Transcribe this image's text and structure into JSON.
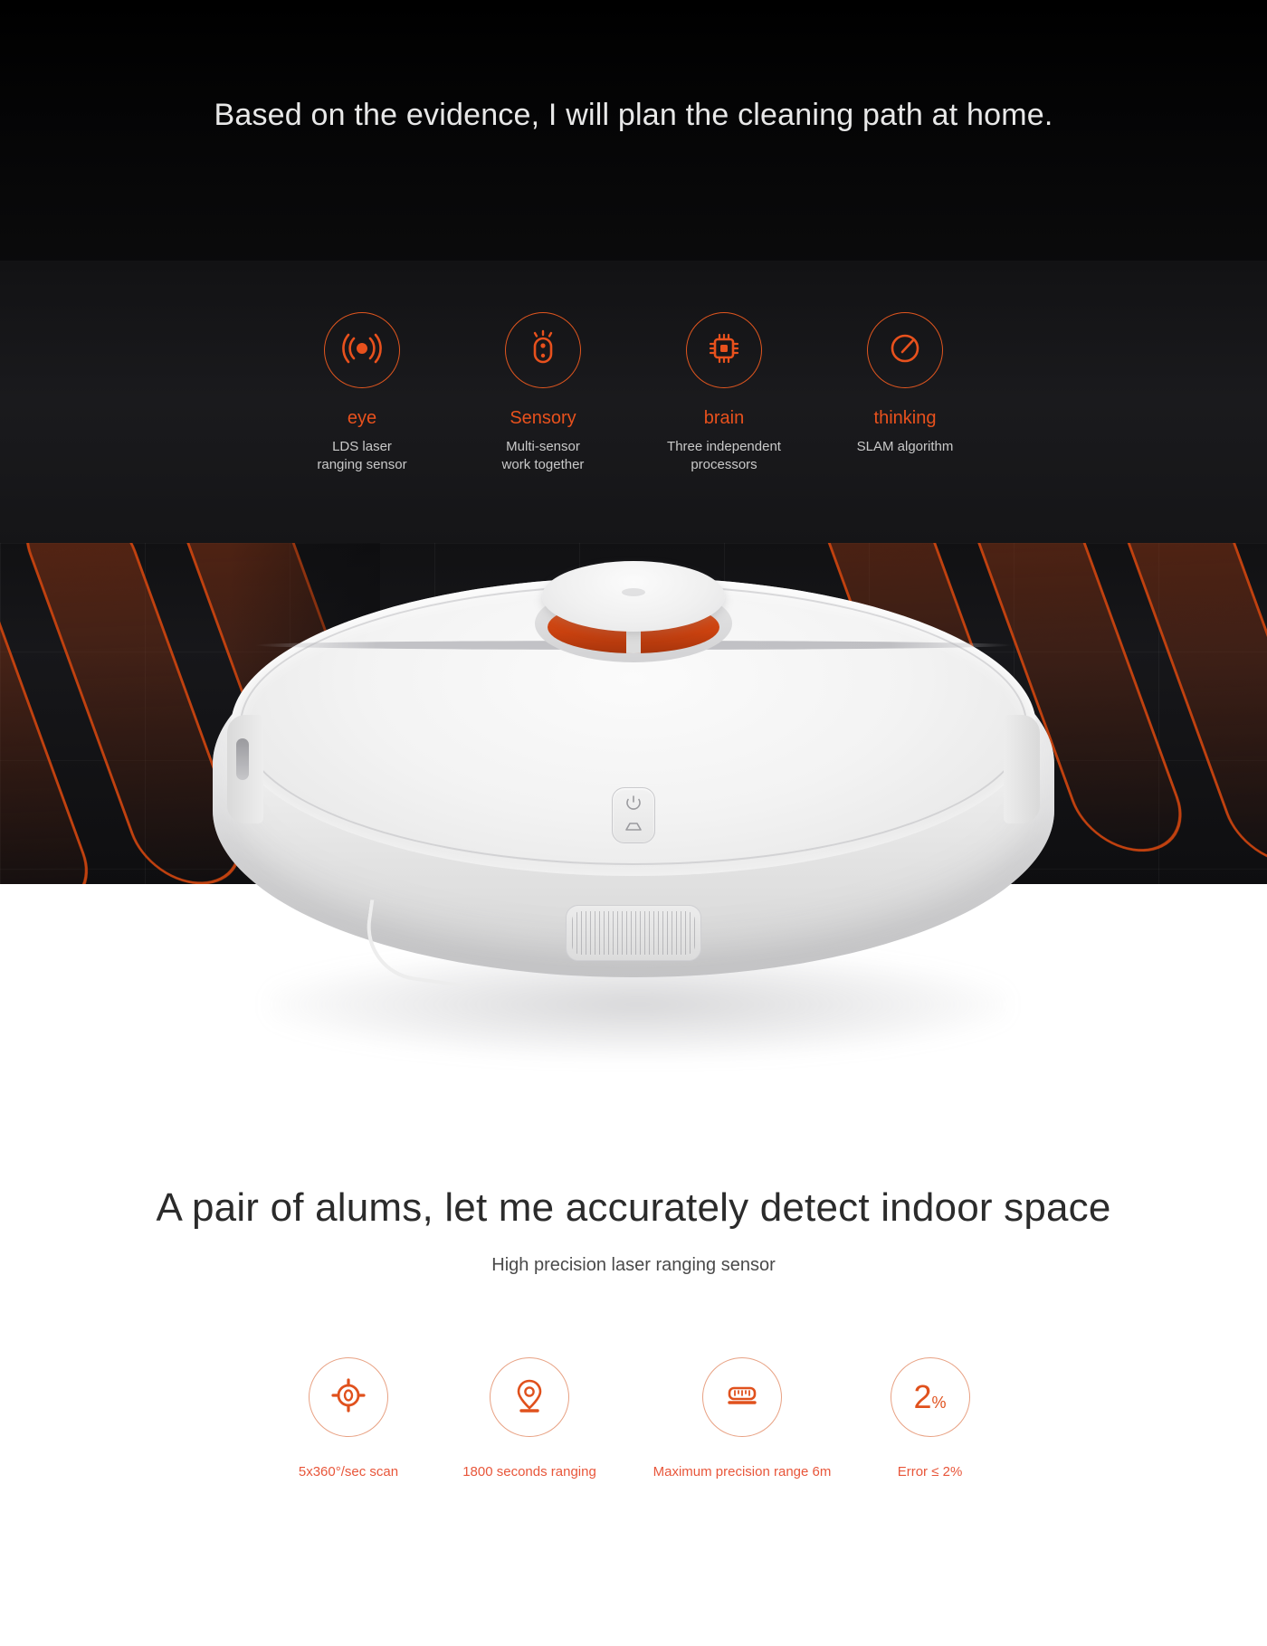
{
  "hero": {
    "headline": "Based on the evidence, I will plan the cleaning path at home.",
    "accent_color": "#e8511d",
    "background_color": "#0d0d0e",
    "features": [
      {
        "icon": "signal-wave-icon",
        "label": "eye",
        "desc_line1": "LDS laser",
        "desc_line2": "ranging sensor"
      },
      {
        "icon": "multi-sensor-icon",
        "label": "Sensory",
        "desc_line1": "Multi-sensor",
        "desc_line2": "work together"
      },
      {
        "icon": "cpu-chip-icon",
        "label": "brain",
        "desc_line1": "Three independent",
        "desc_line2": "processors"
      },
      {
        "icon": "compass-gauge-icon",
        "label": "thinking",
        "desc_line1": "SLAM algorithm",
        "desc_line2": ""
      }
    ]
  },
  "product": {
    "name": "robot-vacuum",
    "power_button_icon": "power-icon",
    "home_button_icon": "home-icon",
    "lds_turret_icon": "lds-laser-turret",
    "body_color": "#f0f0f0",
    "laser_band_color": "#c9410f"
  },
  "lower": {
    "title": "A pair of alums, let me accurately detect indoor space",
    "subtitle": "High precision laser ranging sensor",
    "accent_color": "#e8563a",
    "specs": [
      {
        "icon": "crosshair-target-icon",
        "label": "5x360°/sec scan",
        "value": ""
      },
      {
        "icon": "location-pin-icon",
        "label": "1800 seconds ranging",
        "value": ""
      },
      {
        "icon": "ruler-icon",
        "label": "Maximum precision range 6m",
        "value": ""
      },
      {
        "icon": "percent-2-icon",
        "label": "Error ≤ 2%",
        "value": "2",
        "unit": "%"
      }
    ]
  }
}
